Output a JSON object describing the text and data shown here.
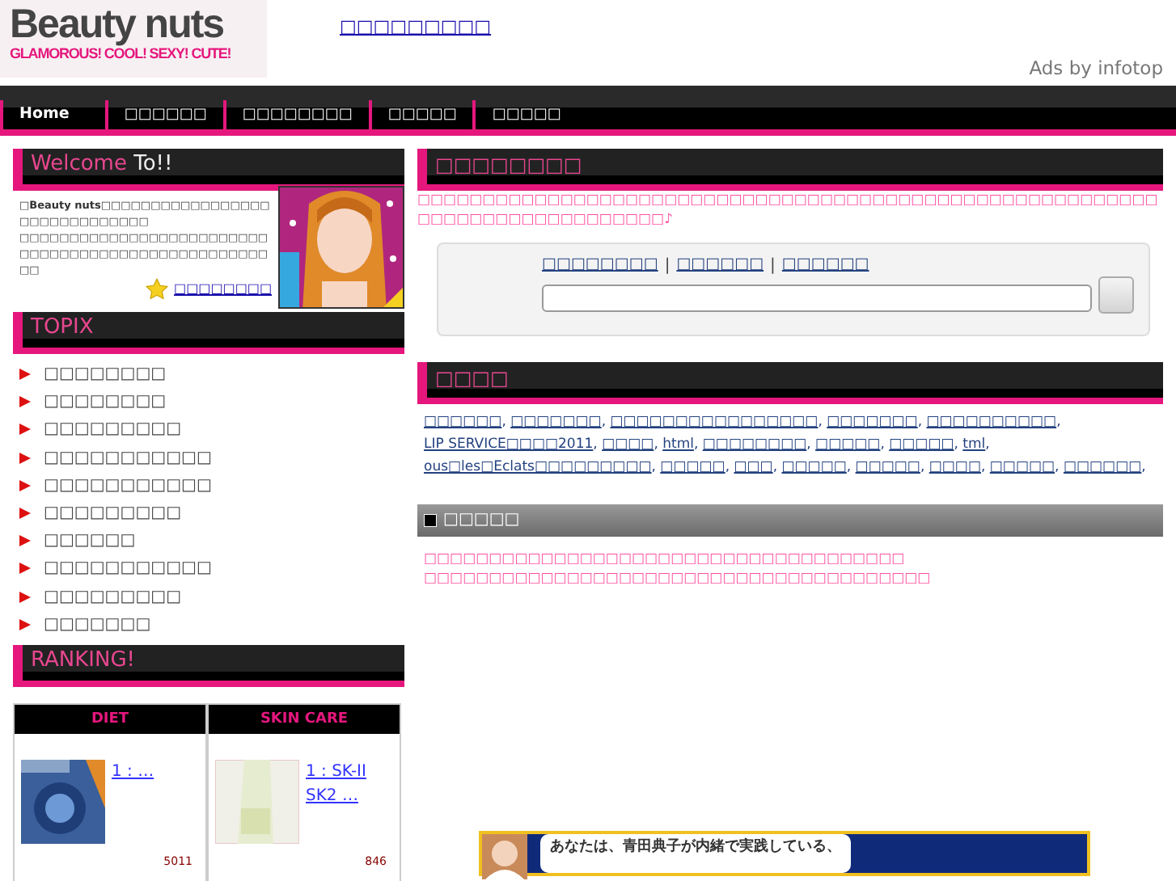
{
  "logo": {
    "title": "Beauty nuts",
    "tagline": "GLAMOROUS! COOL! SEXY! CUTE!"
  },
  "header_link": "□□□□□□□□□",
  "ads_label": "Ads by infotop",
  "nav": [
    {
      "label": "Home",
      "selected": true
    },
    {
      "label": "□□□□□□",
      "selected": false
    },
    {
      "label": "□□□□□□□□",
      "selected": false
    },
    {
      "label": "□□□□□",
      "selected": false
    },
    {
      "label": "□□□□□",
      "selected": false
    }
  ],
  "welcome": {
    "title_a": "Welcome",
    "title_b": "To!!",
    "paragraphs": [
      "**□Beauty nuts□**□□□□□□□□□□□□□□□□□□□□□□□□□□□□□",
      "□□□□□□□*□□□□□□□□*□□□□□□□□□□□□□□□□□□□□□□□□□□□□□□□□□□□□□"
    ],
    "link": "□□□□□□□□"
  },
  "topix": {
    "title": "TOPIX",
    "items": [
      "□□□□□□□□",
      "□□□□□□□□",
      "□□□□□□□□□",
      "□□□□□□□□□□□",
      "□□□□□□□□□□□",
      "□□□□□□□□□",
      "□□□□□□",
      "□□□□□□□□□□□",
      "□□□□□□□□□",
      "□□□□□□□"
    ]
  },
  "ranking": {
    "title": "RANKING!",
    "columns": [
      {
        "heading": "DIET",
        "link": "1 :  …",
        "count": "5011"
      },
      {
        "heading": "SKIN CARE",
        "link": "1 : SK-II SK2 …",
        "count": "846"
      }
    ]
  },
  "intro": {
    "title": "□□□□□□□□",
    "text": "□□□□□□□□□□□□□□□□□□□□□□□□□□□□□□□□□□□□□□□□□□□□□□□□□□□□□□□□□□□□□□□□□□□□□□□□□□□□♪"
  },
  "search": {
    "separator": "|",
    "links": [
      "□□□□□□□□",
      "□□□□□□",
      "□□□□□□"
    ]
  },
  "tags": {
    "title": "□□□□",
    "separator": ",",
    "items": [
      "□□□□□□",
      "□□□□□□□",
      "□□□□□□□□□□□□□□□□",
      "□□□□□□□",
      "□□□□□□□□□□",
      "LIP SERVICE□□□□2011",
      "□□□□",
      "html",
      "□□□□□□□□",
      "□□□□□",
      "□□□□□",
      "tml",
      "ous□les□Eclats□□□□□□□□□",
      "□□□□□",
      "□□□",
      "□□□□□",
      "□□□□□",
      "□□□□",
      "□□□□□",
      "□□□□□□"
    ]
  },
  "notice": {
    "title": "□□□□□",
    "lines": [
      "□□□□□□□□□□□□□□□□□□□□□□□□□□□□□□□□□□□□□",
      "□□□□□□□□□□□□□□□□□□□□□□□□□□□□□□□□□□□□□□□"
    ]
  },
  "banner": {
    "text": "あなたは、**青田典子**が内緒で実践している、"
  }
}
